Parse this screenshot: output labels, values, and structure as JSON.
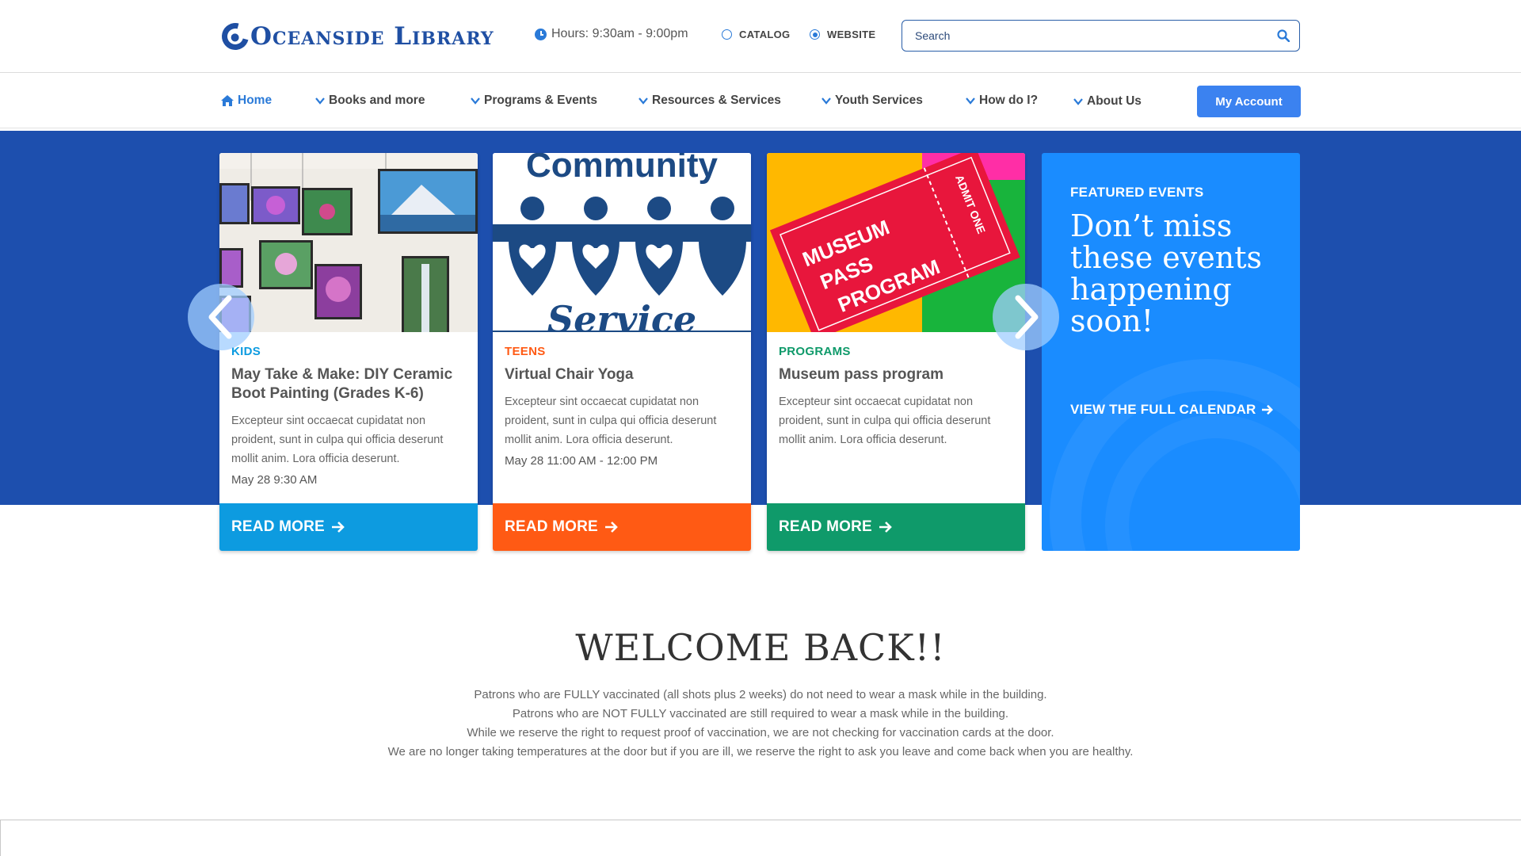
{
  "header": {
    "logo_text": "Oceanside Library",
    "hours": "Hours: 9:30am - 9:00pm",
    "radio_catalog": "CATALOG",
    "radio_website": "WEBSITE",
    "search_placeholder": "Search"
  },
  "nav": {
    "items": [
      {
        "label": "Home",
        "icon": "home-icon"
      },
      {
        "label": "Books and more",
        "icon": "chevron-down-icon"
      },
      {
        "label": "Programs & Events",
        "icon": "chevron-down-icon"
      },
      {
        "label": "Resources & Services",
        "icon": "chevron-down-icon"
      },
      {
        "label": "Youth Services",
        "icon": "chevron-down-icon"
      },
      {
        "label": "How do I?",
        "icon": "chevron-down-icon"
      },
      {
        "label": "About Us",
        "icon": "chevron-down-icon"
      }
    ],
    "account_label": "My Account"
  },
  "cards": [
    {
      "category": "KIDS",
      "title": "May Take & Make: DIY Ceramic Boot Painting (Grades K-6)",
      "description": "Excepteur sint occaecat cupidatat non proident, sunt in culpa qui officia deserunt mollit anim. Lora officia deserunt.",
      "date": "May 28   9:30 AM",
      "button": "READ MORE",
      "color": "#0d9be0"
    },
    {
      "category": "TEENS",
      "title": "Virtual Chair Yoga",
      "description": "Excepteur sint occaecat cupidatat non proident, sunt in culpa qui officia deserunt mollit anim. Lora officia deserunt.",
      "date": "May 28   11:00 AM - 12:00 PM",
      "button": "READ MORE",
      "color": "#ff5a14",
      "image_text_top": "Community",
      "image_text_bottom": "Service"
    },
    {
      "category": "PROGRAMS",
      "title": "Museum pass program",
      "description": "Excepteur sint occaecat cupidatat non proident, sunt in culpa qui officia deserunt mollit anim. Lora officia deserunt.",
      "date": "",
      "button": "READ MORE",
      "color": "#0f9a6a",
      "image_text_lines": [
        "MUSEUM",
        "PASS",
        "PROGRAM"
      ],
      "image_text_stub": "ADMIT ONE"
    }
  ],
  "featured": {
    "kicker": "FEATURED EVENTS",
    "headline": "Don’t miss these events happening soon!",
    "link": "VIEW THE FULL CALENDAR"
  },
  "welcome": {
    "title": "WELCOME BACK!!",
    "lines": [
      "Patrons who are FULLY vaccinated (all shots plus 2 weeks) do not need to wear a mask while in the building.",
      "Patrons who are NOT FULLY vaccinated are still required to wear a mask while in the building.",
      "While we reserve the right to request proof of vaccination, we are not checking for vaccination cards at the door.",
      "We are no longer taking temperatures at the door but if you are ill, we reserve the right to ask you leave and come back when you are healthy."
    ]
  },
  "colors": {
    "brand_blue": "#1f4fa3",
    "hero_blue": "#1d4fae",
    "accent_blue": "#3b82f0",
    "featured_blue": "#1a8cff"
  }
}
